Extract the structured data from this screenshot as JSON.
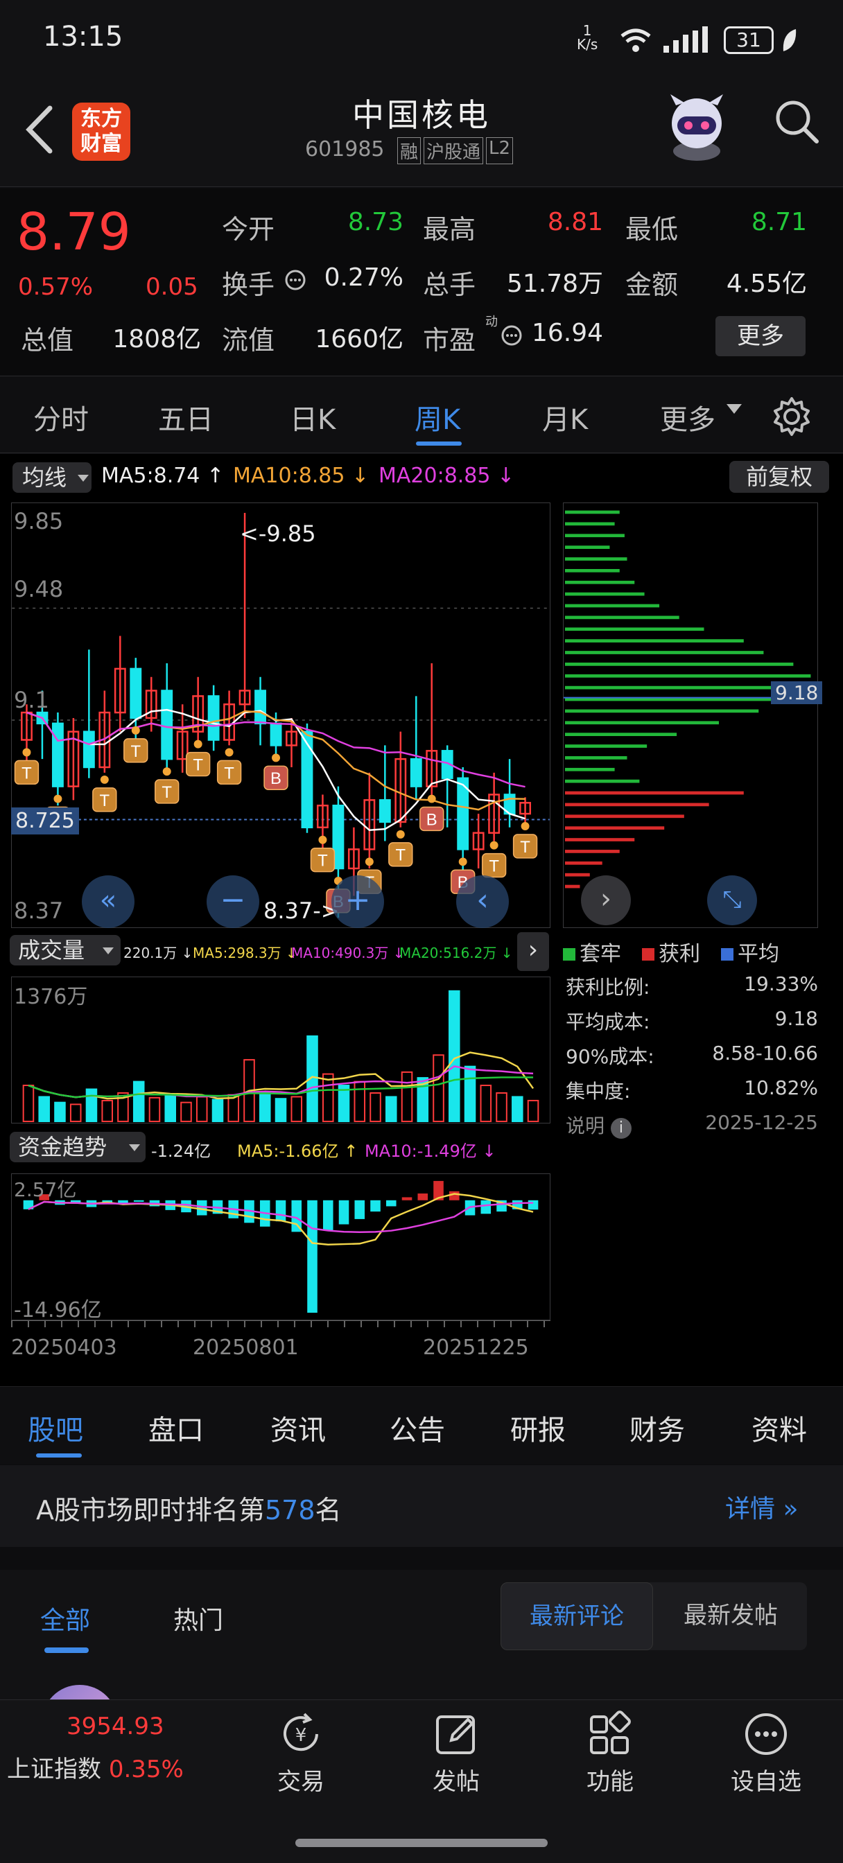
{
  "status": {
    "time": "13:15",
    "net_speed_top": "1",
    "net_speed_unit": "K/s",
    "battery": "31"
  },
  "header": {
    "logo_line1": "东方",
    "logo_line2": "财富",
    "title": "中国核电",
    "code": "601985",
    "tags": [
      "融",
      "沪股通",
      "L2"
    ]
  },
  "quote": {
    "price": "8.79",
    "change_pct": "0.57%",
    "change": "0.05",
    "fields": [
      {
        "label": "今开",
        "value": "8.73",
        "color": "green"
      },
      {
        "label": "最高",
        "value": "8.81",
        "color": "red"
      },
      {
        "label": "最低",
        "value": "8.71",
        "color": "green"
      },
      {
        "label": "换手",
        "value": "0.27%",
        "color": "white"
      },
      {
        "label": "总手",
        "value": "51.78万",
        "color": "white"
      },
      {
        "label": "金额",
        "value": "4.55亿",
        "color": "white"
      },
      {
        "label": "总值",
        "value": "1808亿",
        "color": "white"
      },
      {
        "label": "流值",
        "value": "1660亿",
        "color": "white"
      },
      {
        "label": "市盈",
        "value": "16.94",
        "color": "white"
      }
    ],
    "pe_superscript": "动",
    "more_button": "更多"
  },
  "kline_tabs": [
    "分时",
    "五日",
    "日K",
    "周K",
    "月K",
    "更多"
  ],
  "kline_active": "周K",
  "ma_bar": {
    "selector": "均线",
    "ma5": "MA5:8.74",
    "ma10": "MA10:8.85",
    "ma20": "MA20:8.85",
    "adjust": "前复权"
  },
  "price_chart": {
    "y_labels": [
      "9.85",
      "9.48",
      "9.1",
      "8.725",
      "8.37"
    ],
    "max_note": "<-9.85",
    "min_note": "8.37->",
    "cost_line_value": "9.18",
    "markers": {
      "t": "T",
      "b": "B"
    }
  },
  "chip_panel": {
    "legend": [
      {
        "label": "套牢",
        "color": "#22b83a"
      },
      {
        "label": "获利",
        "color": "#d92b2b"
      },
      {
        "label": "平均",
        "color": "#3a6fd8"
      }
    ],
    "rows": [
      {
        "label": "获利比例:",
        "value": "19.33%"
      },
      {
        "label": "平均成本:",
        "value": "9.18"
      },
      {
        "label": "90%成本:",
        "value": "8.58-10.66"
      },
      {
        "label": "集中度:",
        "value": "10.82%"
      }
    ],
    "note_label": "说明",
    "note_icon": "i",
    "date": "2025-12-25"
  },
  "volume_bar": {
    "selector": "成交量",
    "value": "220.1万",
    "ma5": "MA5:298.3万",
    "ma10": "MA10:490.3万",
    "ma20": "MA20:516.2万",
    "max_label": "1376万"
  },
  "fund_bar": {
    "selector": "资金趋势",
    "value": "-1.24亿",
    "ma5": "MA5:-1.66亿",
    "ma10": "MA10:-1.49亿",
    "top_label": "2.57亿",
    "bottom_label": "-14.96亿"
  },
  "dates": [
    "20250403",
    "20250801",
    "20251225"
  ],
  "bottom_tabs": [
    "股吧",
    "盘口",
    "资讯",
    "公告",
    "研报",
    "财务",
    "资料"
  ],
  "bottom_active": "股吧",
  "rank": {
    "prefix": "A股市场即时排名第",
    "number": "578",
    "suffix": "名",
    "detail": "详情"
  },
  "posts": {
    "tabs": [
      "全部",
      "热门"
    ],
    "sort": [
      "最新评论",
      "最新发帖"
    ]
  },
  "nav": {
    "index_value": "3954.93",
    "index_name": "上证指数",
    "index_change": "0.35%",
    "items": [
      {
        "label": "交易",
        "icon": "trade-icon"
      },
      {
        "label": "发帖",
        "icon": "compose-icon"
      },
      {
        "label": "功能",
        "icon": "grid-icon"
      },
      {
        "label": "设自选",
        "icon": "more-icon"
      }
    ]
  },
  "chart_data": {
    "type": "candlestick",
    "series": [
      {
        "name": "MA5",
        "values": [
          8.74
        ]
      },
      {
        "name": "MA10",
        "values": [
          8.85
        ]
      },
      {
        "name": "MA20",
        "values": [
          8.85
        ]
      }
    ],
    "ylim": [
      8.37,
      9.85
    ],
    "candles": [
      [
        9.02,
        9.12,
        9.15,
        8.92
      ],
      [
        9.12,
        9.08,
        9.2,
        8.95
      ],
      [
        9.08,
        8.85,
        9.12,
        8.78
      ],
      [
        8.85,
        9.05,
        9.1,
        8.8
      ],
      [
        9.05,
        8.92,
        9.35,
        8.88
      ],
      [
        8.92,
        9.12,
        9.2,
        8.9
      ],
      [
        9.12,
        9.28,
        9.4,
        9.05
      ],
      [
        9.28,
        9.1,
        9.32,
        9.02
      ],
      [
        9.1,
        9.2,
        9.25,
        9.05
      ],
      [
        9.2,
        8.95,
        9.3,
        8.9
      ],
      [
        8.95,
        9.05,
        9.15,
        8.9
      ],
      [
        9.05,
        9.18,
        9.25,
        9.0
      ],
      [
        9.18,
        9.02,
        9.22,
        8.98
      ],
      [
        9.02,
        9.15,
        9.2,
        9.0
      ],
      [
        9.15,
        9.2,
        9.85,
        9.1
      ],
      [
        9.2,
        9.08,
        9.25,
        9.0
      ],
      [
        9.08,
        9.0,
        9.12,
        8.95
      ],
      [
        9.0,
        9.05,
        9.1,
        8.92
      ],
      [
        9.05,
        8.7,
        9.08,
        8.68
      ],
      [
        8.7,
        8.78,
        8.82,
        8.62
      ],
      [
        8.78,
        8.55,
        8.85,
        8.37
      ],
      [
        8.55,
        8.62,
        8.7,
        8.45
      ],
      [
        8.62,
        8.8,
        8.9,
        8.55
      ],
      [
        8.8,
        8.72,
        9.0,
        8.65
      ],
      [
        8.72,
        8.95,
        9.05,
        8.7
      ],
      [
        8.95,
        8.85,
        9.18,
        8.8
      ],
      [
        8.85,
        8.98,
        9.3,
        8.8
      ],
      [
        8.98,
        8.88,
        9.0,
        8.7
      ],
      [
        8.88,
        8.62,
        8.92,
        8.52
      ],
      [
        8.62,
        8.68,
        8.75,
        8.55
      ],
      [
        8.68,
        8.82,
        8.9,
        8.65
      ],
      [
        8.82,
        8.75,
        8.95,
        8.7
      ],
      [
        8.75,
        8.79,
        8.81,
        8.71
      ]
    ],
    "volume_max": 1376,
    "volume": [
      380,
      260,
      200,
      180,
      340,
      220,
      300,
      420,
      250,
      270,
      200,
      260,
      230,
      280,
      650,
      300,
      240,
      260,
      900,
      500,
      380,
      420,
      300,
      260,
      520,
      460,
      700,
      1376,
      580,
      380,
      300,
      260,
      220
    ],
    "fund_flow": [
      -1.2,
      0.8,
      -0.6,
      -0.4,
      -0.9,
      -0.3,
      -0.5,
      -0.2,
      -0.8,
      -1.3,
      -1.6,
      -2.0,
      -1.8,
      -2.4,
      -3.0,
      -3.5,
      -2.8,
      -4.2,
      -14.96,
      -4.0,
      -3.2,
      -2.5,
      -1.5,
      -0.8,
      0.4,
      0.9,
      2.57,
      1.2,
      -2.0,
      -1.8,
      -1.5,
      -1.2,
      -1.24
    ],
    "chip_rows": [
      {
        "v": 0.22,
        "c": "g"
      },
      {
        "v": 0.2,
        "c": "g"
      },
      {
        "v": 0.24,
        "c": "g"
      },
      {
        "v": 0.18,
        "c": "g"
      },
      {
        "v": 0.25,
        "c": "g"
      },
      {
        "v": 0.22,
        "c": "g"
      },
      {
        "v": 0.28,
        "c": "g"
      },
      {
        "v": 0.32,
        "c": "g"
      },
      {
        "v": 0.38,
        "c": "g"
      },
      {
        "v": 0.46,
        "c": "g"
      },
      {
        "v": 0.56,
        "c": "g"
      },
      {
        "v": 0.72,
        "c": "g"
      },
      {
        "v": 0.8,
        "c": "g"
      },
      {
        "v": 0.92,
        "c": "g"
      },
      {
        "v": 0.99,
        "c": "g"
      },
      {
        "v": 0.88,
        "c": "g"
      },
      {
        "v": 0.95,
        "c": "g"
      },
      {
        "v": 0.78,
        "c": "g"
      },
      {
        "v": 0.62,
        "c": "g"
      },
      {
        "v": 0.45,
        "c": "g"
      },
      {
        "v": 0.33,
        "c": "g"
      },
      {
        "v": 0.25,
        "c": "g"
      },
      {
        "v": 0.2,
        "c": "g"
      },
      {
        "v": 0.3,
        "c": "g"
      },
      {
        "v": 0.72,
        "c": "r"
      },
      {
        "v": 0.58,
        "c": "r"
      },
      {
        "v": 0.48,
        "c": "r"
      },
      {
        "v": 0.4,
        "c": "r"
      },
      {
        "v": 0.28,
        "c": "r"
      },
      {
        "v": 0.22,
        "c": "r"
      },
      {
        "v": 0.15,
        "c": "r"
      },
      {
        "v": 0.1,
        "c": "r"
      },
      {
        "v": 0.06,
        "c": "r"
      }
    ]
  }
}
